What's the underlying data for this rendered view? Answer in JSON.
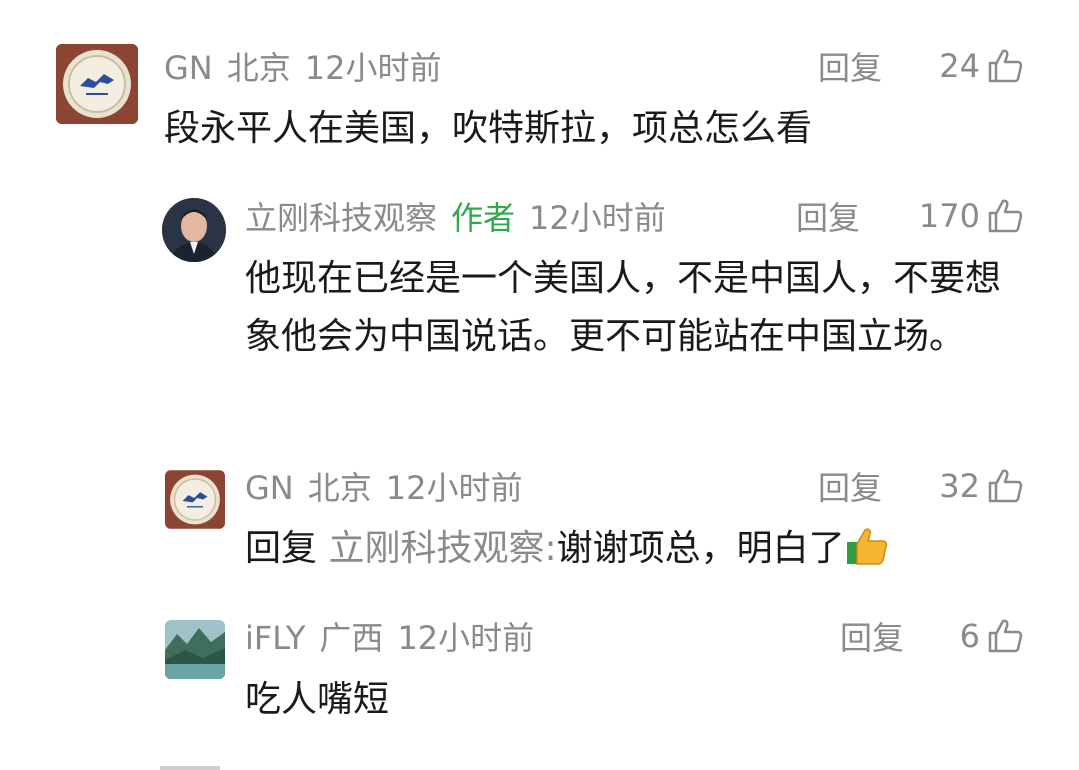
{
  "comments": [
    {
      "user": "GN",
      "location": "北京",
      "time": "12小时前",
      "reply_label": "回复",
      "likes": "24",
      "text": "段永平人在美国，吹特斯拉，项总怎么看"
    },
    {
      "user": "立刚科技观察",
      "author_tag": "作者",
      "time": "12小时前",
      "reply_label": "回复",
      "likes": "170",
      "text": "他现在已经是一个美国人，不是中国人，不要想象他会为中国说话。更不可能站在中国立场。"
    },
    {
      "user": "GN",
      "location": "北京",
      "time": "12小时前",
      "reply_label": "回复",
      "likes": "32",
      "reply_prefix": "回复",
      "reply_target": "立刚科技观察:",
      "text": "谢谢项总，明白了",
      "emoji": "thumbs-up-emoji"
    },
    {
      "user": "iFLY",
      "location": "广西",
      "time": "12小时前",
      "reply_label": "回复",
      "likes": "6",
      "text": "吃人嘴短"
    }
  ],
  "colors": {
    "meta_gray": "#8a8a8a",
    "author_green": "#2fa84f",
    "text": "#1a1a1a"
  }
}
